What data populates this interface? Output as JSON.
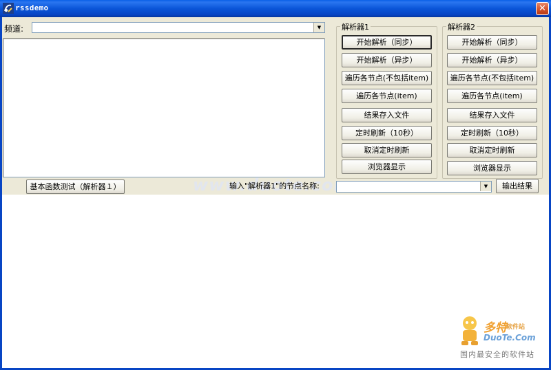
{
  "window": {
    "title": "rssdemo",
    "close_glyph": "✕"
  },
  "channel": {
    "label": "频道:",
    "value": ""
  },
  "parser1": {
    "title": "解析器1",
    "buttons": [
      "开始解析（同步）",
      "开始解析（异步）",
      "遍历各节点(不包括item)",
      "遍历各节点(item)",
      "结果存入文件",
      "定时刷新（10秒）",
      "取消定时刷新",
      "浏览器显示"
    ]
  },
  "parser2": {
    "title": "解析器2",
    "buttons": [
      "开始解析（同步）",
      "开始解析（异步）",
      "遍历各节点(不包括item)",
      "遍历各节点(item)",
      "结果存入文件",
      "定时刷新（10秒）",
      "取消定时刷新",
      "浏览器显示"
    ]
  },
  "bottom": {
    "basic_test_label": "基本函数测试（解析器１）",
    "node_name_label": "输入\"解析器1\"的节点名称:",
    "node_value": "",
    "output_label": "输出结果"
  },
  "watermark": "www.duote.com",
  "logo": {
    "brand": "多特",
    "brand_sub": "软件站",
    "domain": "DuoTe.Com",
    "slogan": "国内最安全的软件站"
  },
  "colors": {
    "titlebar": "#0a55d8",
    "face": "#ece9d8",
    "close": "#d4542c"
  }
}
